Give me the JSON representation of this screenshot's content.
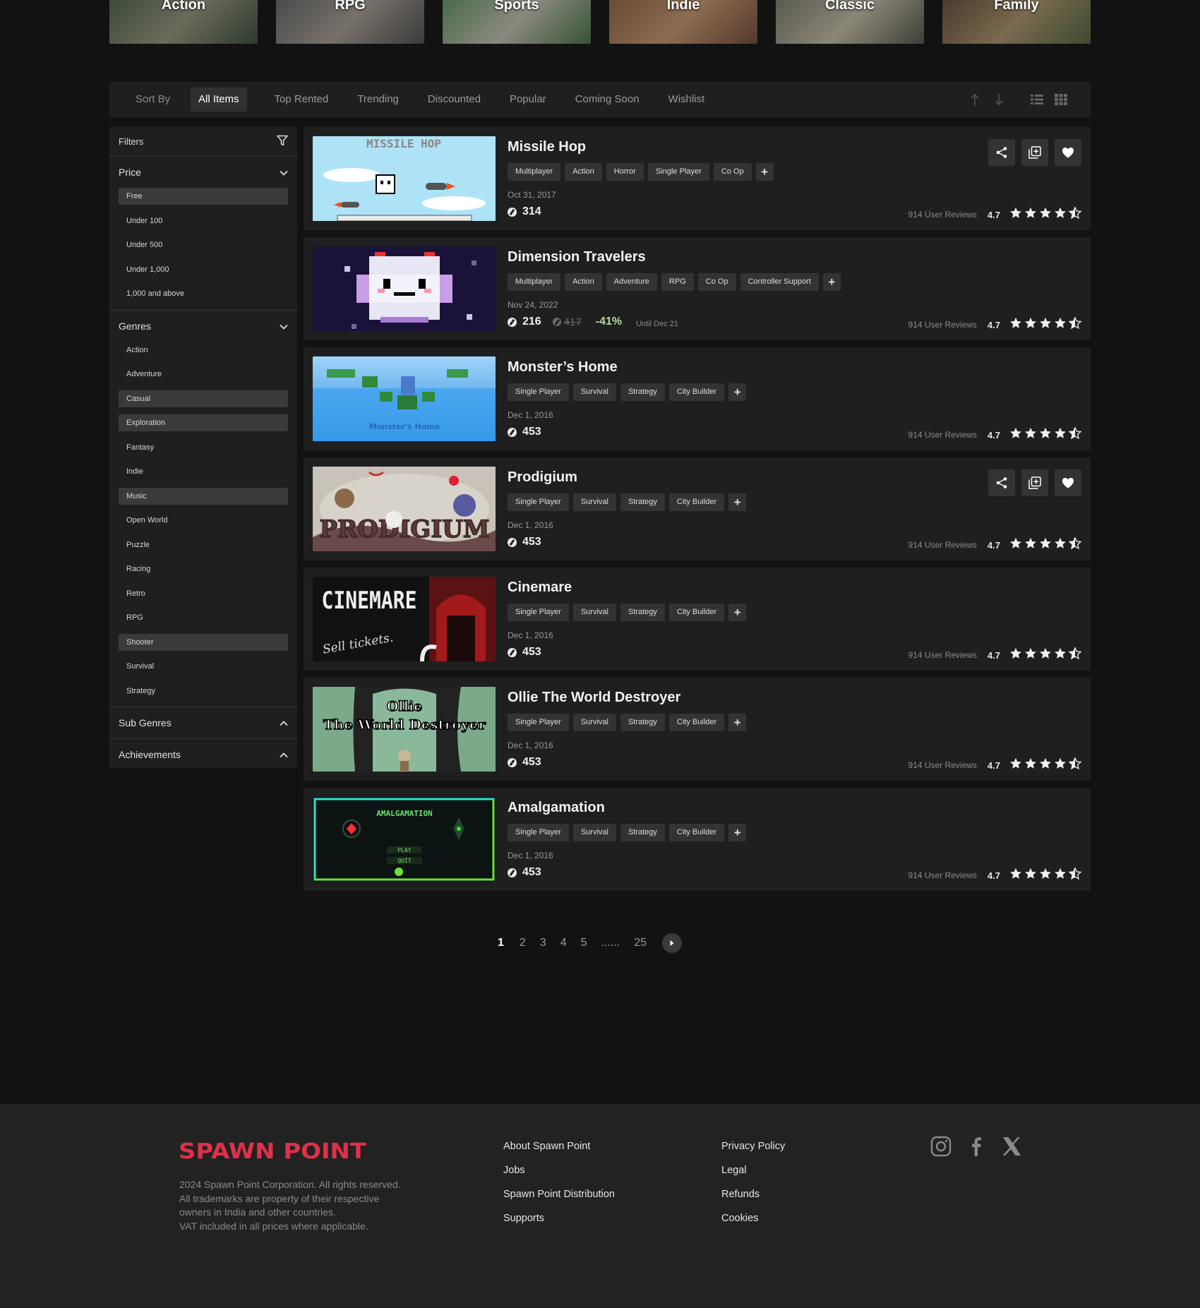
{
  "categories": [
    {
      "label": "Action",
      "colors": [
        "#3d4a3a",
        "#6b6b5c",
        "#2c3a2f"
      ]
    },
    {
      "label": "RPG",
      "colors": [
        "#4c4c4c",
        "#767069",
        "#3b3b3b"
      ]
    },
    {
      "label": "Sports",
      "colors": [
        "#4b6a4b",
        "#8a8a80",
        "#365236"
      ]
    },
    {
      "label": "Indie",
      "colors": [
        "#6a4a35",
        "#8c6d52",
        "#54382a"
      ]
    },
    {
      "label": "Classic",
      "colors": [
        "#5a5a50",
        "#8a8678",
        "#3f3f38"
      ]
    },
    {
      "label": "Family",
      "colors": [
        "#4a3a2a",
        "#7a6a50",
        "#3c4a2f"
      ]
    }
  ],
  "sort": {
    "label": "Sort By",
    "tabs": [
      "All Items",
      "Top Rented",
      "Trending",
      "Discounted",
      "Popular",
      "Coming Soon",
      "Wishlist"
    ]
  },
  "filters": {
    "title": "Filters",
    "price": {
      "label": "Price",
      "items": [
        "Free",
        "Under 100",
        "Under 500",
        "Under 1,000",
        "1,000 and above"
      ]
    },
    "genres": {
      "label": "Genres",
      "items": [
        "Action",
        "Adventure",
        "Casual",
        "Exploration",
        "Fantasy",
        "Indie",
        "Music",
        "Open World",
        "Puzzle",
        "Racing",
        "Retro",
        "RPG",
        "Shooter",
        "Survival",
        "Strategy"
      ]
    },
    "sub_genres": "Sub Genres",
    "achievements": "Achievements"
  },
  "games": [
    {
      "title": "Missile Hop",
      "tags": [
        "Multiplayer",
        "Action",
        "Horror",
        "Single Player",
        "Co Op"
      ],
      "date": "Oct 31, 2017",
      "price": "314",
      "reviews": "914 User Reviews",
      "rating": "4.7",
      "thumb_text": "MISSILE HOP"
    },
    {
      "title": "Dimension Travelers",
      "tags": [
        "Multiplayer",
        "Action",
        "Adventure",
        "RPG",
        "Co Op",
        "Controller Support"
      ],
      "date": "Nov 24, 2022",
      "price": "216",
      "original_price": "417",
      "discount": "-41%",
      "until": "Until Dec 21",
      "reviews": "914 User Reviews",
      "rating": "4.7"
    },
    {
      "title": "Monster’s Home",
      "tags": [
        "Single Player",
        "Survival",
        "Strategy",
        "City Builder"
      ],
      "date": "Dec 1, 2016",
      "price": "453",
      "reviews": "914 User Reviews",
      "rating": "4.7",
      "thumb_text": "Monster's Home"
    },
    {
      "title": "Prodigium",
      "tags": [
        "Single Player",
        "Survival",
        "Strategy",
        "City Builder"
      ],
      "date": "Dec 1, 2016",
      "price": "453",
      "reviews": "914 User Reviews",
      "rating": "4.7",
      "thumb_text": "PRODIGIUM"
    },
    {
      "title": "Cinemare",
      "tags": [
        "Single Player",
        "Survival",
        "Strategy",
        "City Builder"
      ],
      "date": "Dec 1, 2016",
      "price": "453",
      "reviews": "914 User Reviews",
      "rating": "4.7",
      "thumb_text": "CINEMARE",
      "thumb_sub": "Sell tickets."
    },
    {
      "title": "Ollie The World Destroyer",
      "tags": [
        "Single Player",
        "Survival",
        "Strategy",
        "City Builder"
      ],
      "date": "Dec 1, 2016",
      "price": "453",
      "reviews": "914 User Reviews",
      "rating": "4.7",
      "thumb_text": "Ollie",
      "thumb_sub": "The World Destroyer"
    },
    {
      "title": "Amalgamation",
      "tags": [
        "Single Player",
        "Survival",
        "Strategy",
        "City Builder"
      ],
      "date": "Dec 1, 2016",
      "price": "453",
      "reviews": "914 User Reviews",
      "rating": "4.7",
      "thumb_text": "AMALGAMATION",
      "thumb_play": "PLAY",
      "thumb_quit": "QUIT"
    }
  ],
  "pagination": {
    "pages": [
      "1",
      "2",
      "3",
      "4",
      "5",
      "......",
      "25"
    ],
    "current": "1"
  },
  "footer": {
    "logo": "SPAWN POINT",
    "copyright": [
      "2024 Spawn Point Corporation. All rights reserved.",
      "All trademarks are property of their respective",
      "owners in India and other countries.",
      "VAT included in all prices where applicable."
    ],
    "col1": [
      "About Spawn Point",
      "Jobs",
      "Spawn Point Distribution",
      "Supports"
    ],
    "col2": [
      "Privacy Policy",
      "Legal",
      "Refunds",
      "Cookies"
    ],
    "social": [
      "instagram-icon",
      "facebook-icon",
      "x-icon"
    ]
  },
  "colors": {
    "bg": "#121212",
    "panel": "#1f1f1f",
    "tag": "#333333",
    "accent": "#e0304a",
    "discount": "#b7d9a0"
  }
}
